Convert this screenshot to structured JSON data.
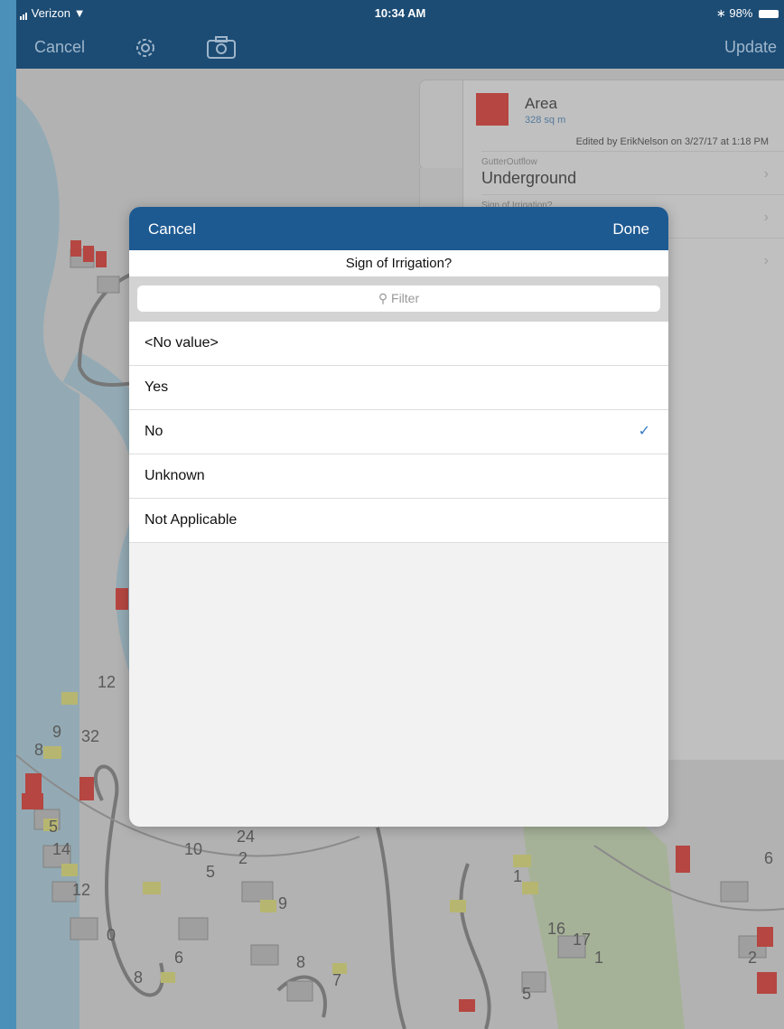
{
  "status_bar": {
    "carrier": "Verizon",
    "time": "10:34 AM",
    "battery": "98%"
  },
  "nav": {
    "cancel": "Cancel",
    "update": "Update",
    "settings_icon": "gear-icon",
    "camera_icon": "camera-icon"
  },
  "feature_panel": {
    "title": "Area",
    "subtitle": "328 sq m",
    "edited": "Edited by ErikNelson on 3/27/17 at 1:18 PM",
    "fields": [
      {
        "label": "GutterOutflow",
        "value": "Underground"
      },
      {
        "label": "Sign of Irrigation?",
        "value": ""
      }
    ],
    "swatch_color": "#e2231a"
  },
  "picker": {
    "cancel": "Cancel",
    "done": "Done",
    "title": "Sign of Irrigation?",
    "filter_placeholder": "Filter",
    "options": [
      "<No value>",
      "Yes",
      "No",
      "Unknown",
      "Not Applicable"
    ],
    "selected_index": 2,
    "header_color": "#1e5a92"
  },
  "map_labels": [
    "12",
    "9",
    "8",
    "32",
    "5",
    "14",
    "12",
    "0",
    "6",
    "8",
    "10",
    "5",
    "24",
    "2",
    "9",
    "8",
    "7",
    "1",
    "16",
    "17",
    "1",
    "5",
    "2",
    "6"
  ]
}
